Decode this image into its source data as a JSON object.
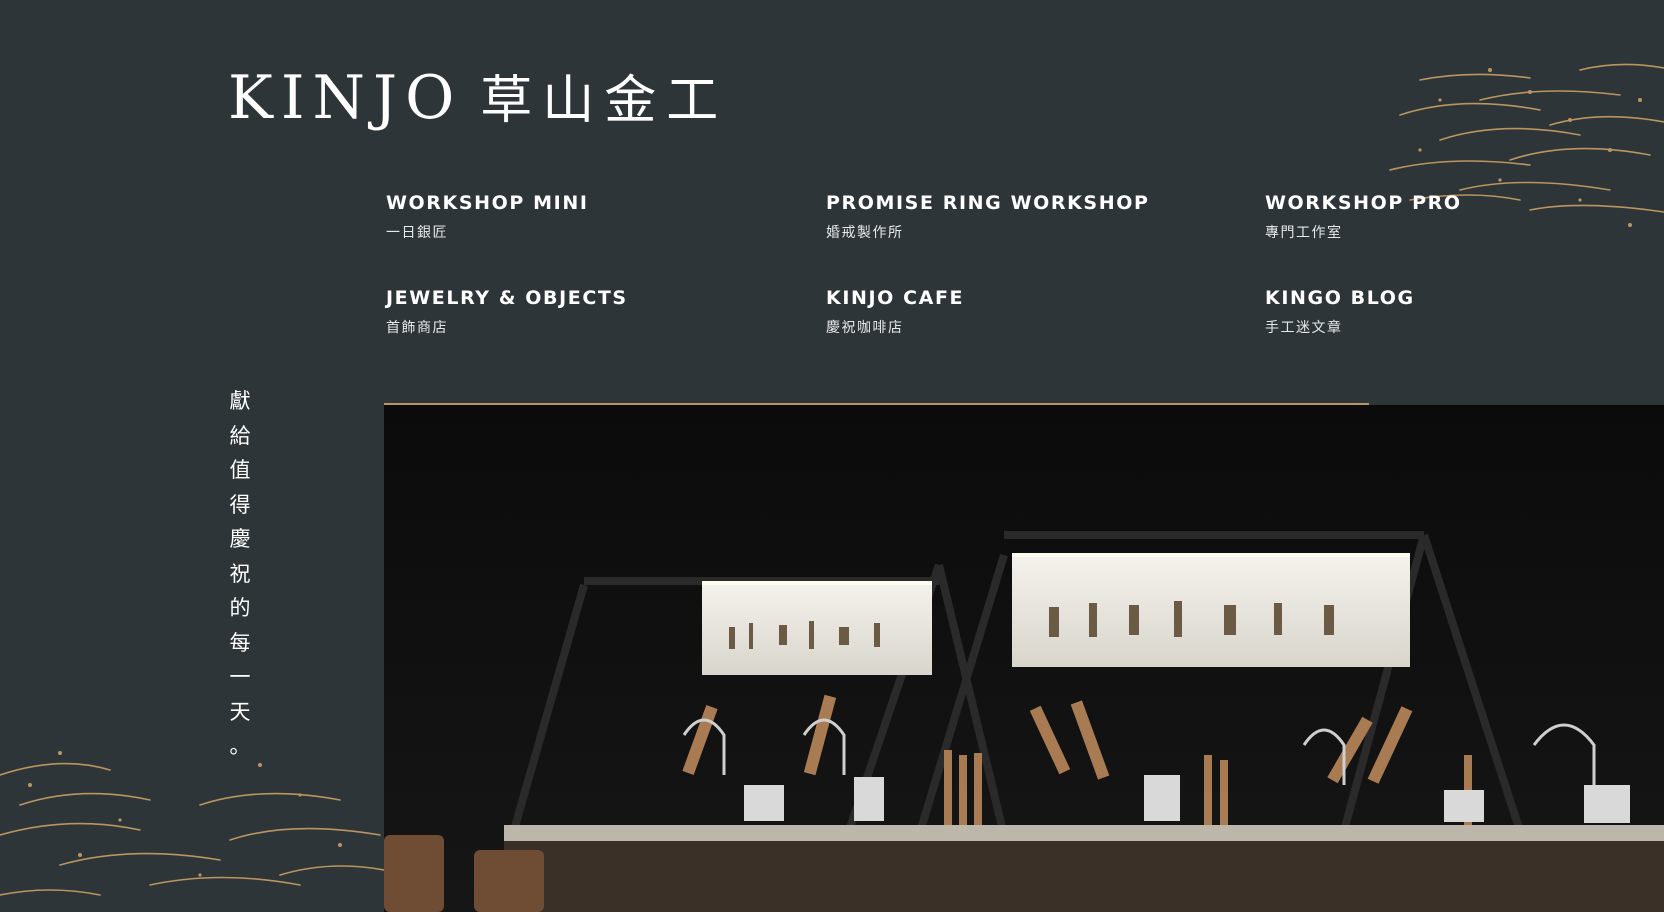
{
  "brand": {
    "name_en": "KINJO",
    "name_zh": "草山金工"
  },
  "nav": {
    "items": [
      {
        "en": "WORKSHOP MINI",
        "zh": "一日銀匠"
      },
      {
        "en": "PROMISE RING WORKSHOP",
        "zh": "婚戒製作所"
      },
      {
        "en": "WORKSHOP PRO",
        "zh": "專門工作室"
      },
      {
        "en": "JEWELRY & OBJECTS",
        "zh": "首飾商店"
      },
      {
        "en": "KINJO CAFE",
        "zh": "慶祝咖啡店"
      },
      {
        "en": "KINGO BLOG",
        "zh": "手工迷文章"
      }
    ]
  },
  "tagline": [
    "獻",
    "給",
    "值",
    "得",
    "慶",
    "祝",
    "的",
    "每",
    "一",
    "天",
    "。"
  ],
  "colors": {
    "background": "#2e3539",
    "accent_gold": "#b9955f",
    "text": "#ffffff"
  }
}
